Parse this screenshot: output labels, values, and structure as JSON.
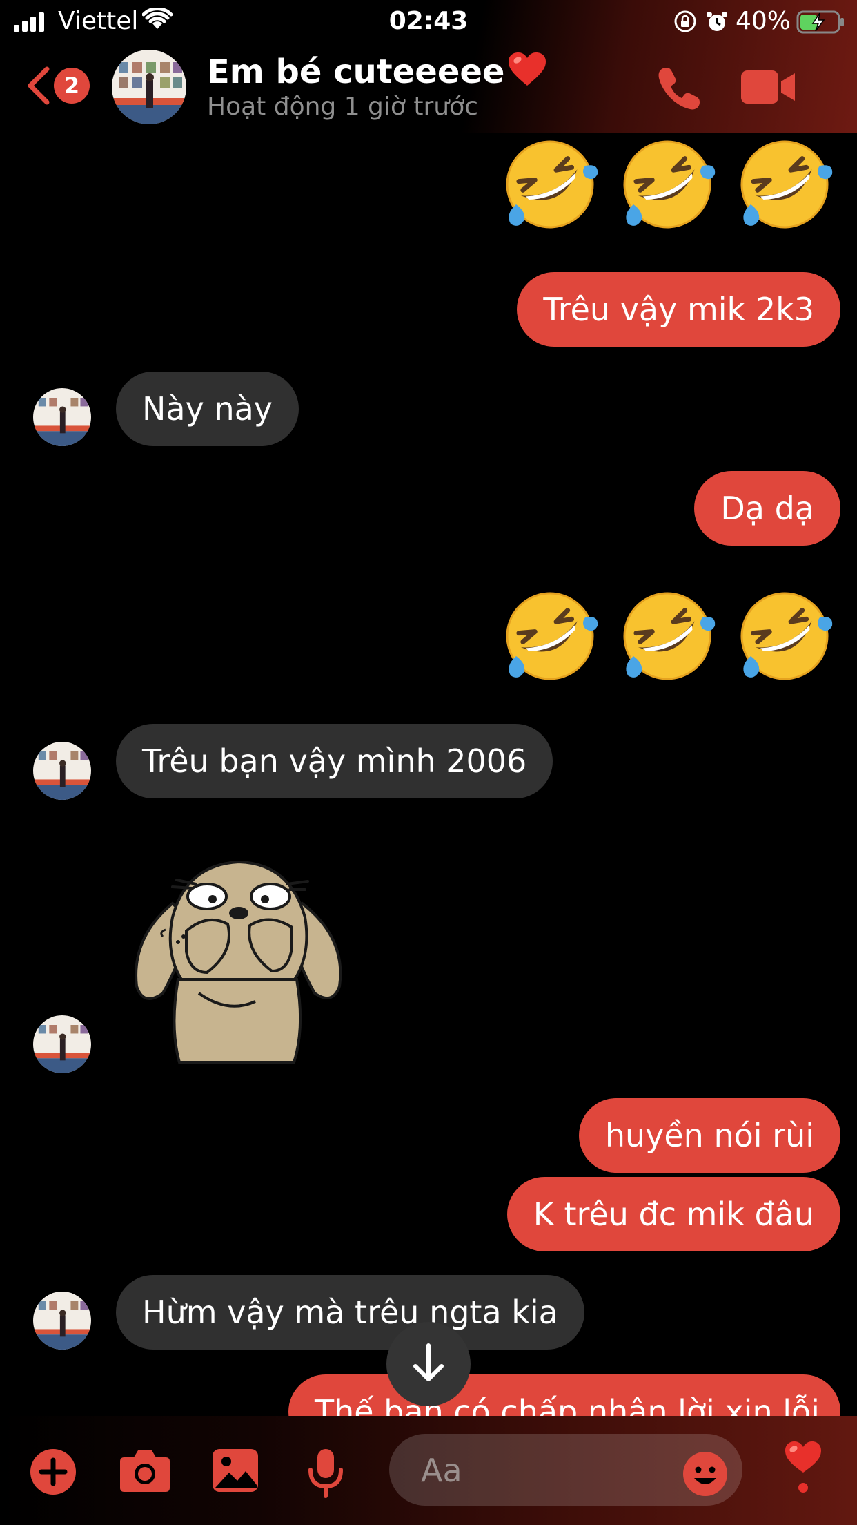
{
  "status_bar": {
    "carrier": "Viettel",
    "time": "02:43",
    "battery_percent": "40%"
  },
  "header": {
    "back_badge_count": "2",
    "contact_name": "Em bé cuteeeee",
    "contact_status": "Hoạt động 1 giờ trước"
  },
  "messages": {
    "m1_emojis": [
      "🤣",
      "🤣",
      "🤣"
    ],
    "m2_text": "Trêu vậy mik 2k3",
    "m3_text": "Này này",
    "m4_text": "Dạ dạ",
    "m5_emojis": [
      "🤣",
      "🤣",
      "🤣"
    ],
    "m6_text": "Trêu bạn vậy mình 2006",
    "m8_text": "huyền nói rùi",
    "m9_text": "K trêu đc mik đâu",
    "m10_text": "Hừm vậy mà trêu ngta kia",
    "m11_text": "Thế bạn có chấp nhận lời xin lỗi"
  },
  "composer": {
    "placeholder": "Aa"
  },
  "colors": {
    "accent": "#e0473c",
    "incoming_bubble": "#303030",
    "background": "#000000"
  },
  "icons": [
    "back-chevron-icon",
    "phone-icon",
    "video-camera-icon",
    "plus-icon",
    "camera-icon",
    "image-icon",
    "microphone-icon",
    "smiley-icon",
    "heart-icon",
    "arrow-down-icon"
  ]
}
